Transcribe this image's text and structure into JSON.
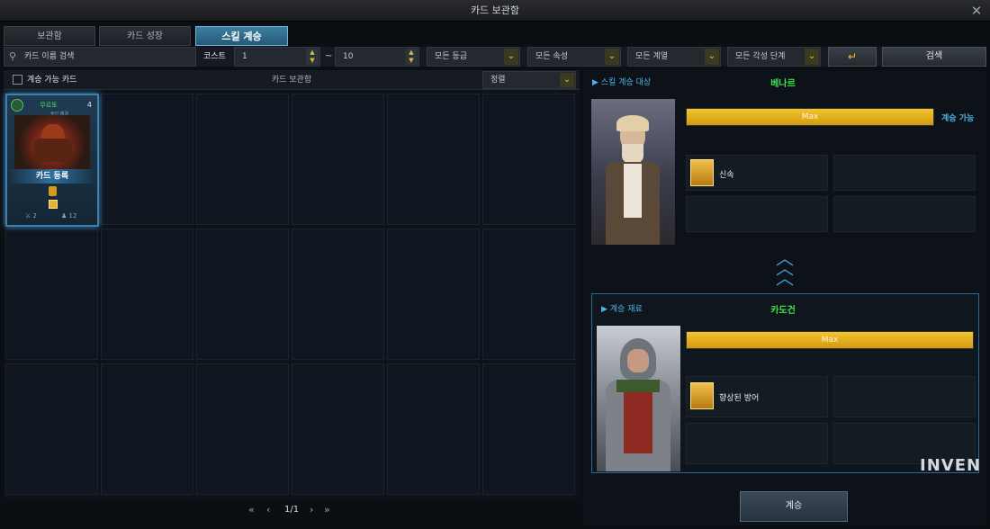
{
  "window": {
    "title": "카드 보관함"
  },
  "tabs": [
    {
      "label": "보관함"
    },
    {
      "label": "카드 성장"
    },
    {
      "label": "스킬 계승"
    }
  ],
  "filters": {
    "search_placeholder": "카드 이름 검색",
    "cost_label": "코스트",
    "cost_min": "1",
    "cost_sep": "~",
    "cost_max": "10",
    "grade": "모든 등급",
    "attribute": "모든 속성",
    "series": "모든 계열",
    "awaken": "모든 각성 단계",
    "search_button": "검색"
  },
  "list_header": {
    "checkbox_label": "계승 가능 카드",
    "title": "카드 보관함",
    "sort_label": "정렬"
  },
  "card": {
    "attribute_tag": "무르토",
    "level": "4",
    "sub_text": "주인 해결",
    "register_label": "카드 등록",
    "stat_attack": "2",
    "stat_count": "12"
  },
  "pagination": {
    "first": "«",
    "prev": "‹",
    "page": "1/1",
    "next": "›",
    "last": "»"
  },
  "target": {
    "section_label": "▶ 스킬 계승 대상",
    "name": "베나르",
    "bar_text": "Max",
    "bar_value": 1.0,
    "status": "계승 가능",
    "skill_name": "신속"
  },
  "material": {
    "section_label": "▶ 계승 재료",
    "name": "카도건",
    "bar_text": "Max",
    "bar_value": 1.0,
    "skill_name": "향상된 방어"
  },
  "confirm_button": "계승",
  "watermark": "INVEN"
}
